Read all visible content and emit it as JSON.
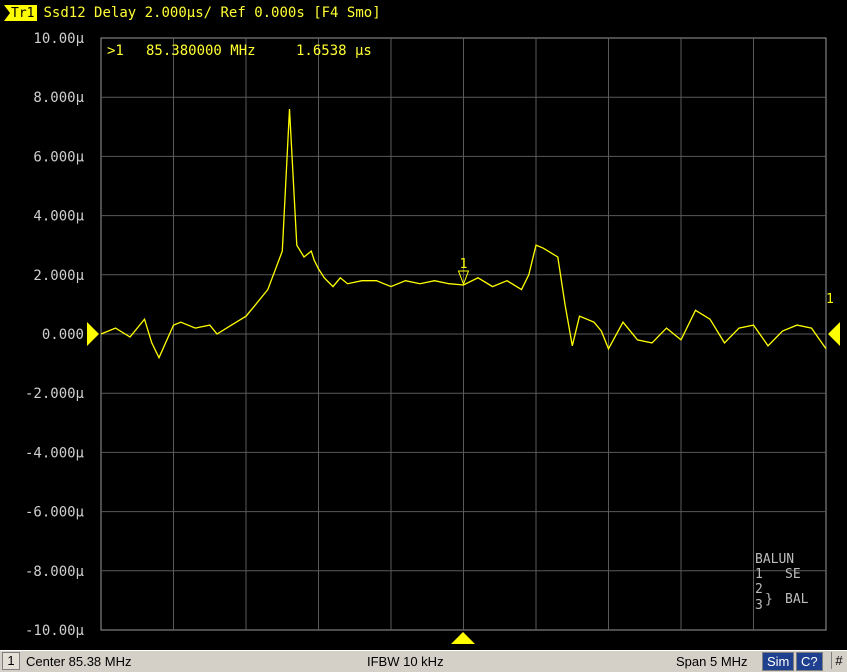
{
  "trace_header": {
    "trace_label": "Tr1",
    "text": "Ssd12 Delay 2.000µs/ Ref 0.000s [F4 Smo]"
  },
  "marker_readout": {
    "pointer": ">1",
    "frequency": "85.380000 MHz",
    "value": "1.6538 µs"
  },
  "balun_legend": {
    "title": "BALUN",
    "row1_port": "1",
    "row1_type": "SE",
    "row2_port": "2",
    "row3_port": "3",
    "brace": "}",
    "row23_type": "BAL"
  },
  "end_marker_label": "1",
  "status_bar": {
    "channel": "1",
    "center": "Center 85.38 MHz",
    "ifbw": "IFBW 10 kHz",
    "span": "Span 5 MHz",
    "sim": "Sim",
    "cal": "C?",
    "hash": "#"
  },
  "colors": {
    "trace": "#ffff00",
    "grid": "#5a5a5a",
    "text": "#cfcfcf",
    "background": "#000000"
  },
  "chart_data": {
    "type": "line",
    "title": "",
    "xlabel": "",
    "ylabel": "",
    "x_unit": "MHz",
    "xlim": [
      82.88,
      87.88
    ],
    "ylim": [
      -10,
      10
    ],
    "y_unit": "µs",
    "grid": true,
    "y_ticks": [
      10,
      8,
      6,
      4,
      2,
      0,
      -2,
      -4,
      -6,
      -8,
      -10
    ],
    "y_tick_labels": [
      "10.00µ",
      "8.000µ",
      "6.000µ",
      "4.000µ",
      "2.000µ",
      "0.000",
      "-2.000µ",
      "-4.000µ",
      "-6.000µ",
      "-8.000µ",
      "-10.00µ"
    ],
    "reference_level": 0,
    "marker": {
      "label": "1",
      "x": 85.38,
      "y": 1.6538
    },
    "series": [
      {
        "x": [
          82.88,
          82.98,
          83.08,
          83.18,
          83.23,
          83.28,
          83.38,
          83.43,
          83.53,
          83.63,
          83.68,
          83.78,
          83.88,
          83.93,
          84.03,
          84.13,
          84.18,
          84.23,
          84.28,
          84.33,
          84.35,
          84.38,
          84.42,
          84.48,
          84.53,
          84.58,
          84.68,
          84.78,
          84.88,
          84.98,
          85.08,
          85.18,
          85.28,
          85.38,
          85.48,
          85.58,
          85.68,
          85.78,
          85.83,
          85.88,
          85.93,
          86.03,
          86.08,
          86.13,
          86.18,
          86.28,
          86.33,
          86.38,
          86.48,
          86.58,
          86.68,
          86.78,
          86.88,
          86.98,
          87.08,
          87.18,
          87.28,
          87.38,
          87.48,
          87.58,
          87.68,
          87.78,
          87.88
        ],
        "y": [
          0.0,
          0.2,
          -0.1,
          0.5,
          -0.3,
          -0.8,
          0.3,
          0.4,
          0.2,
          0.3,
          0.0,
          0.3,
          0.6,
          0.9,
          1.5,
          2.8,
          7.6,
          3.0,
          2.6,
          2.8,
          2.5,
          2.2,
          1.9,
          1.6,
          1.9,
          1.7,
          1.8,
          1.8,
          1.6,
          1.8,
          1.7,
          1.8,
          1.7,
          1.6538,
          1.9,
          1.6,
          1.8,
          1.5,
          2.0,
          3.0,
          2.9,
          2.6,
          1.0,
          -0.4,
          0.6,
          0.4,
          0.1,
          -0.5,
          0.4,
          -0.2,
          -0.3,
          0.2,
          -0.2,
          0.8,
          0.5,
          -0.3,
          0.2,
          0.3,
          -0.4,
          0.1,
          0.3,
          0.2,
          -0.5
        ]
      }
    ]
  }
}
